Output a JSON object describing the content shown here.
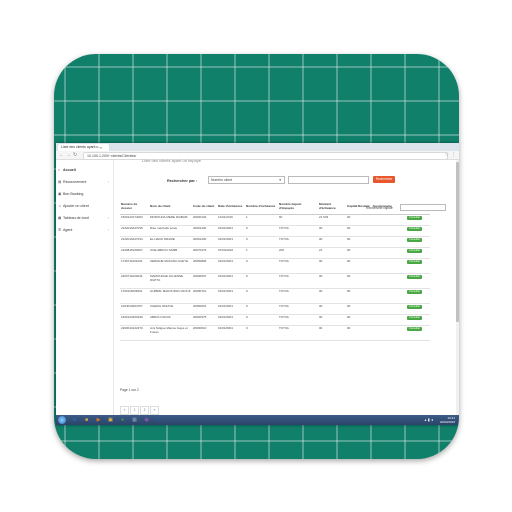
{
  "browser": {
    "tab_title": "Liste des clients ayant u...",
    "url": "10.100.1.200/~clients/Clientes/"
  },
  "sidebar": {
    "items": [
      {
        "label": "Accueil",
        "icon": "home-icon",
        "glyph": "⌂"
      },
      {
        "label": "Recouvrement",
        "icon": "money-icon",
        "glyph": "▤"
      },
      {
        "label": "Bon Banking",
        "icon": "card-icon",
        "glyph": "▣"
      },
      {
        "label": "Ajouter un client",
        "icon": "user-add-icon",
        "glyph": "☺"
      },
      {
        "label": "Tableau de bord",
        "icon": "dashboard-icon",
        "glyph": "▦"
      },
      {
        "label": "Agent",
        "icon": "agent-icon",
        "glyph": "☰"
      }
    ]
  },
  "page": {
    "title": "Liste des clients ayant un impayé"
  },
  "search": {
    "label": "Rechercher par :",
    "select_value": "Numéro client",
    "button": "Rechercher",
    "quick_label": "Recherche rapide"
  },
  "table": {
    "headers": [
      "Numéro de dossier",
      "Nom du client",
      "Code du client",
      "Date d'échéance",
      "Nombre d'échéance",
      "Nombre depuis d'impayés",
      "Montant d'échéance",
      "Capital Restant",
      "Gestionnaire",
      ""
    ],
    "rows": [
      [
        "1500123174003",
        "MODOUNA MERE DIABAM",
        "20000104",
        "11/01/2016",
        "1",
        "60",
        "21 533",
        "00",
        "",
        "Consulter"
      ],
      [
        "2122016427035",
        "Dieu méchelle écrav",
        "20091400",
        "01/01/0001",
        "0",
        "TOTVA",
        "00",
        "00",
        "",
        "Consulter"
      ],
      [
        "2122016427034",
        "EL HADJI DRAME",
        "20091400",
        "01/01/0001",
        "0",
        "TOTVA",
        "00",
        "00",
        "",
        "Consulter"
      ],
      [
        "2100815160007",
        "UOE ABDOU SAMB",
        "20070476",
        "07/04/2016",
        "1",
        "200",
        "21",
        "00",
        "",
        "Consulter"
      ],
      [
        "1730711001034",
        "SERIGNE MAKANA GUEYE",
        "20050806",
        "01/01/0001",
        "0",
        "TOTVA",
        "00",
        "00",
        "",
        "Consulter"
      ],
      [
        "2200711020044",
        "MAMOUDHE JULIENNE DIATTA",
        "20000007",
        "01/01/0001",
        "0",
        "TOTVA",
        "00",
        "00",
        "",
        "Consulter"
      ],
      [
        "1700116009001",
        "GUIBRIL MAKOUDOU DIOUF",
        "20090710",
        "01/01/0001",
        "0",
        "TOTVA",
        "00",
        "00",
        "",
        "Consulter"
      ],
      [
        "1004010004767",
        "CHEIKH NDIAYE",
        "20050001",
        "01/01/0001",
        "0",
        "TOTVA",
        "00",
        "00",
        "",
        "Consulter"
      ],
      [
        "1600120400336",
        "ABDOU DIOUF",
        "20000375",
        "01/01/0001",
        "0",
        "TOTVA",
        "00",
        "00",
        "",
        "Consulter"
      ],
      [
        "2200010122370",
        "Ami Ndigue Mamou Gaye et Freres",
        "20000010",
        "01/01/0001",
        "0",
        "TOTVA",
        "00",
        "00",
        "",
        "Consulter"
      ]
    ]
  },
  "pagination": {
    "info": "Page 1 sur 2",
    "pages": [
      "«",
      "1",
      "2",
      "»"
    ]
  },
  "taskbar": {
    "time": "10:41",
    "date": "20/04/2016",
    "apps": [
      {
        "icon": "ie-icon",
        "glyph": "e",
        "color": "#1f7fd6"
      },
      {
        "icon": "folder-icon",
        "glyph": "■",
        "color": "#e0b040"
      },
      {
        "icon": "media-icon",
        "glyph": "▶",
        "color": "#e07a20"
      },
      {
        "icon": "explorer-icon",
        "glyph": "▣",
        "color": "#f0c040"
      },
      {
        "icon": "chrome-icon",
        "glyph": "●",
        "color": "#3aa757"
      },
      {
        "icon": "calc-icon",
        "glyph": "▦",
        "color": "#8aa0b8"
      },
      {
        "icon": "app-icon",
        "glyph": "◉",
        "color": "#9b59b6"
      },
      {
        "icon": "word-icon",
        "glyph": "W",
        "color": "#2b5797"
      }
    ]
  },
  "colors": {
    "tile": "#10806b",
    "search_button": "#e8562d",
    "consult_button": "#49a844"
  }
}
